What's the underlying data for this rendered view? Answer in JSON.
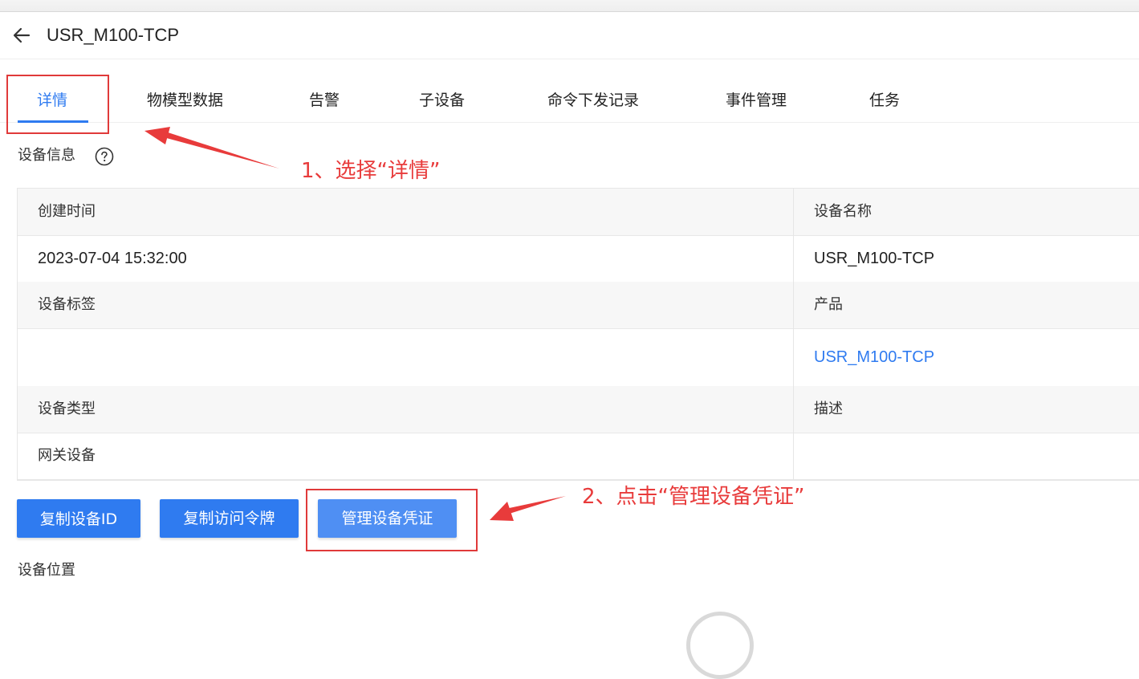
{
  "header": {
    "title": "USR_M100-TCP",
    "back_icon": "arrow-left-icon"
  },
  "tabs": [
    {
      "label": "详情",
      "active": true
    },
    {
      "label": "物模型数据",
      "active": false
    },
    {
      "label": "告警",
      "active": false
    },
    {
      "label": "子设备",
      "active": false
    },
    {
      "label": "命令下发记录",
      "active": false
    },
    {
      "label": "事件管理",
      "active": false
    },
    {
      "label": "任务",
      "active": false
    }
  ],
  "device_info": {
    "section_title": "设备信息",
    "help_icon": "question-circle-icon",
    "fields": {
      "created_time_label": "创建时间",
      "created_time_value": "2023-07-04 15:32:00",
      "device_name_label": "设备名称",
      "device_name_value": "USR_M100-TCP",
      "tags_label": "设备标签",
      "tags_value": "",
      "product_label": "产品",
      "product_value": "USR_M100-TCP",
      "type_label": "设备类型",
      "type_value": "网关设备",
      "description_label": "描述",
      "description_value": ""
    }
  },
  "actions": {
    "copy_id": "复制设备ID",
    "copy_token": "复制访问令牌",
    "manage_credentials": "管理设备凭证"
  },
  "location": {
    "section_title": "设备位置"
  },
  "annotations": {
    "step1": "1、选择“详情”",
    "step2": "2、点击“管理设备凭证”"
  },
  "colors": {
    "accent": "#2f7bf0",
    "annotation": "#e83b3b"
  }
}
